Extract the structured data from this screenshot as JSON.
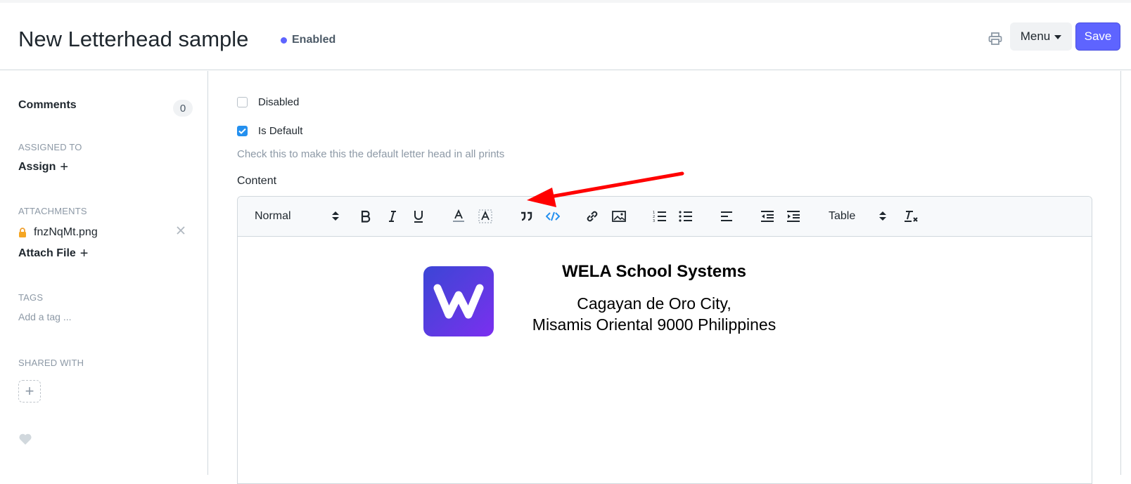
{
  "page": {
    "title": "New Letterhead sample",
    "status": "Enabled",
    "status_color": "#5e64ff"
  },
  "actions": {
    "print_icon": "printer-icon",
    "menu_label": "Menu",
    "save_label": "Save",
    "primary_color": "#5e64ff"
  },
  "sidebar": {
    "comments_label": "Comments",
    "comments_count": "0",
    "assigned_to_label": "ASSIGNED TO",
    "assign_label": "Assign",
    "attachments_label": "ATTACHMENTS",
    "attachment_file": "fnzNqMt.png",
    "attach_file_label": "Attach File",
    "tags_label": "TAGS",
    "tag_placeholder": "Add a tag ...",
    "shared_with_label": "SHARED WITH"
  },
  "form": {
    "disabled_label": "Disabled",
    "disabled_checked": false,
    "is_default_label": "Is Default",
    "is_default_checked": true,
    "is_default_help": "Check this to make this the default letter head in all prints",
    "content_label": "Content"
  },
  "toolbar": {
    "heading_select": "Normal",
    "table_select": "Table",
    "icons": [
      "bold-icon",
      "italic-icon",
      "underline-icon",
      "font-color-icon",
      "background-color-icon",
      "blockquote-icon",
      "code-block-icon",
      "link-icon",
      "image-icon",
      "ordered-list-icon",
      "bullet-list-icon",
      "align-icon",
      "outdent-icon",
      "indent-icon",
      "clear-format-icon"
    ]
  },
  "letterhead": {
    "logo_letter": "W",
    "company": "WELA School Systems",
    "address_line1": "Cagayan de Oro City,",
    "address_line2": "Misamis Oriental 9000 Philippines"
  }
}
